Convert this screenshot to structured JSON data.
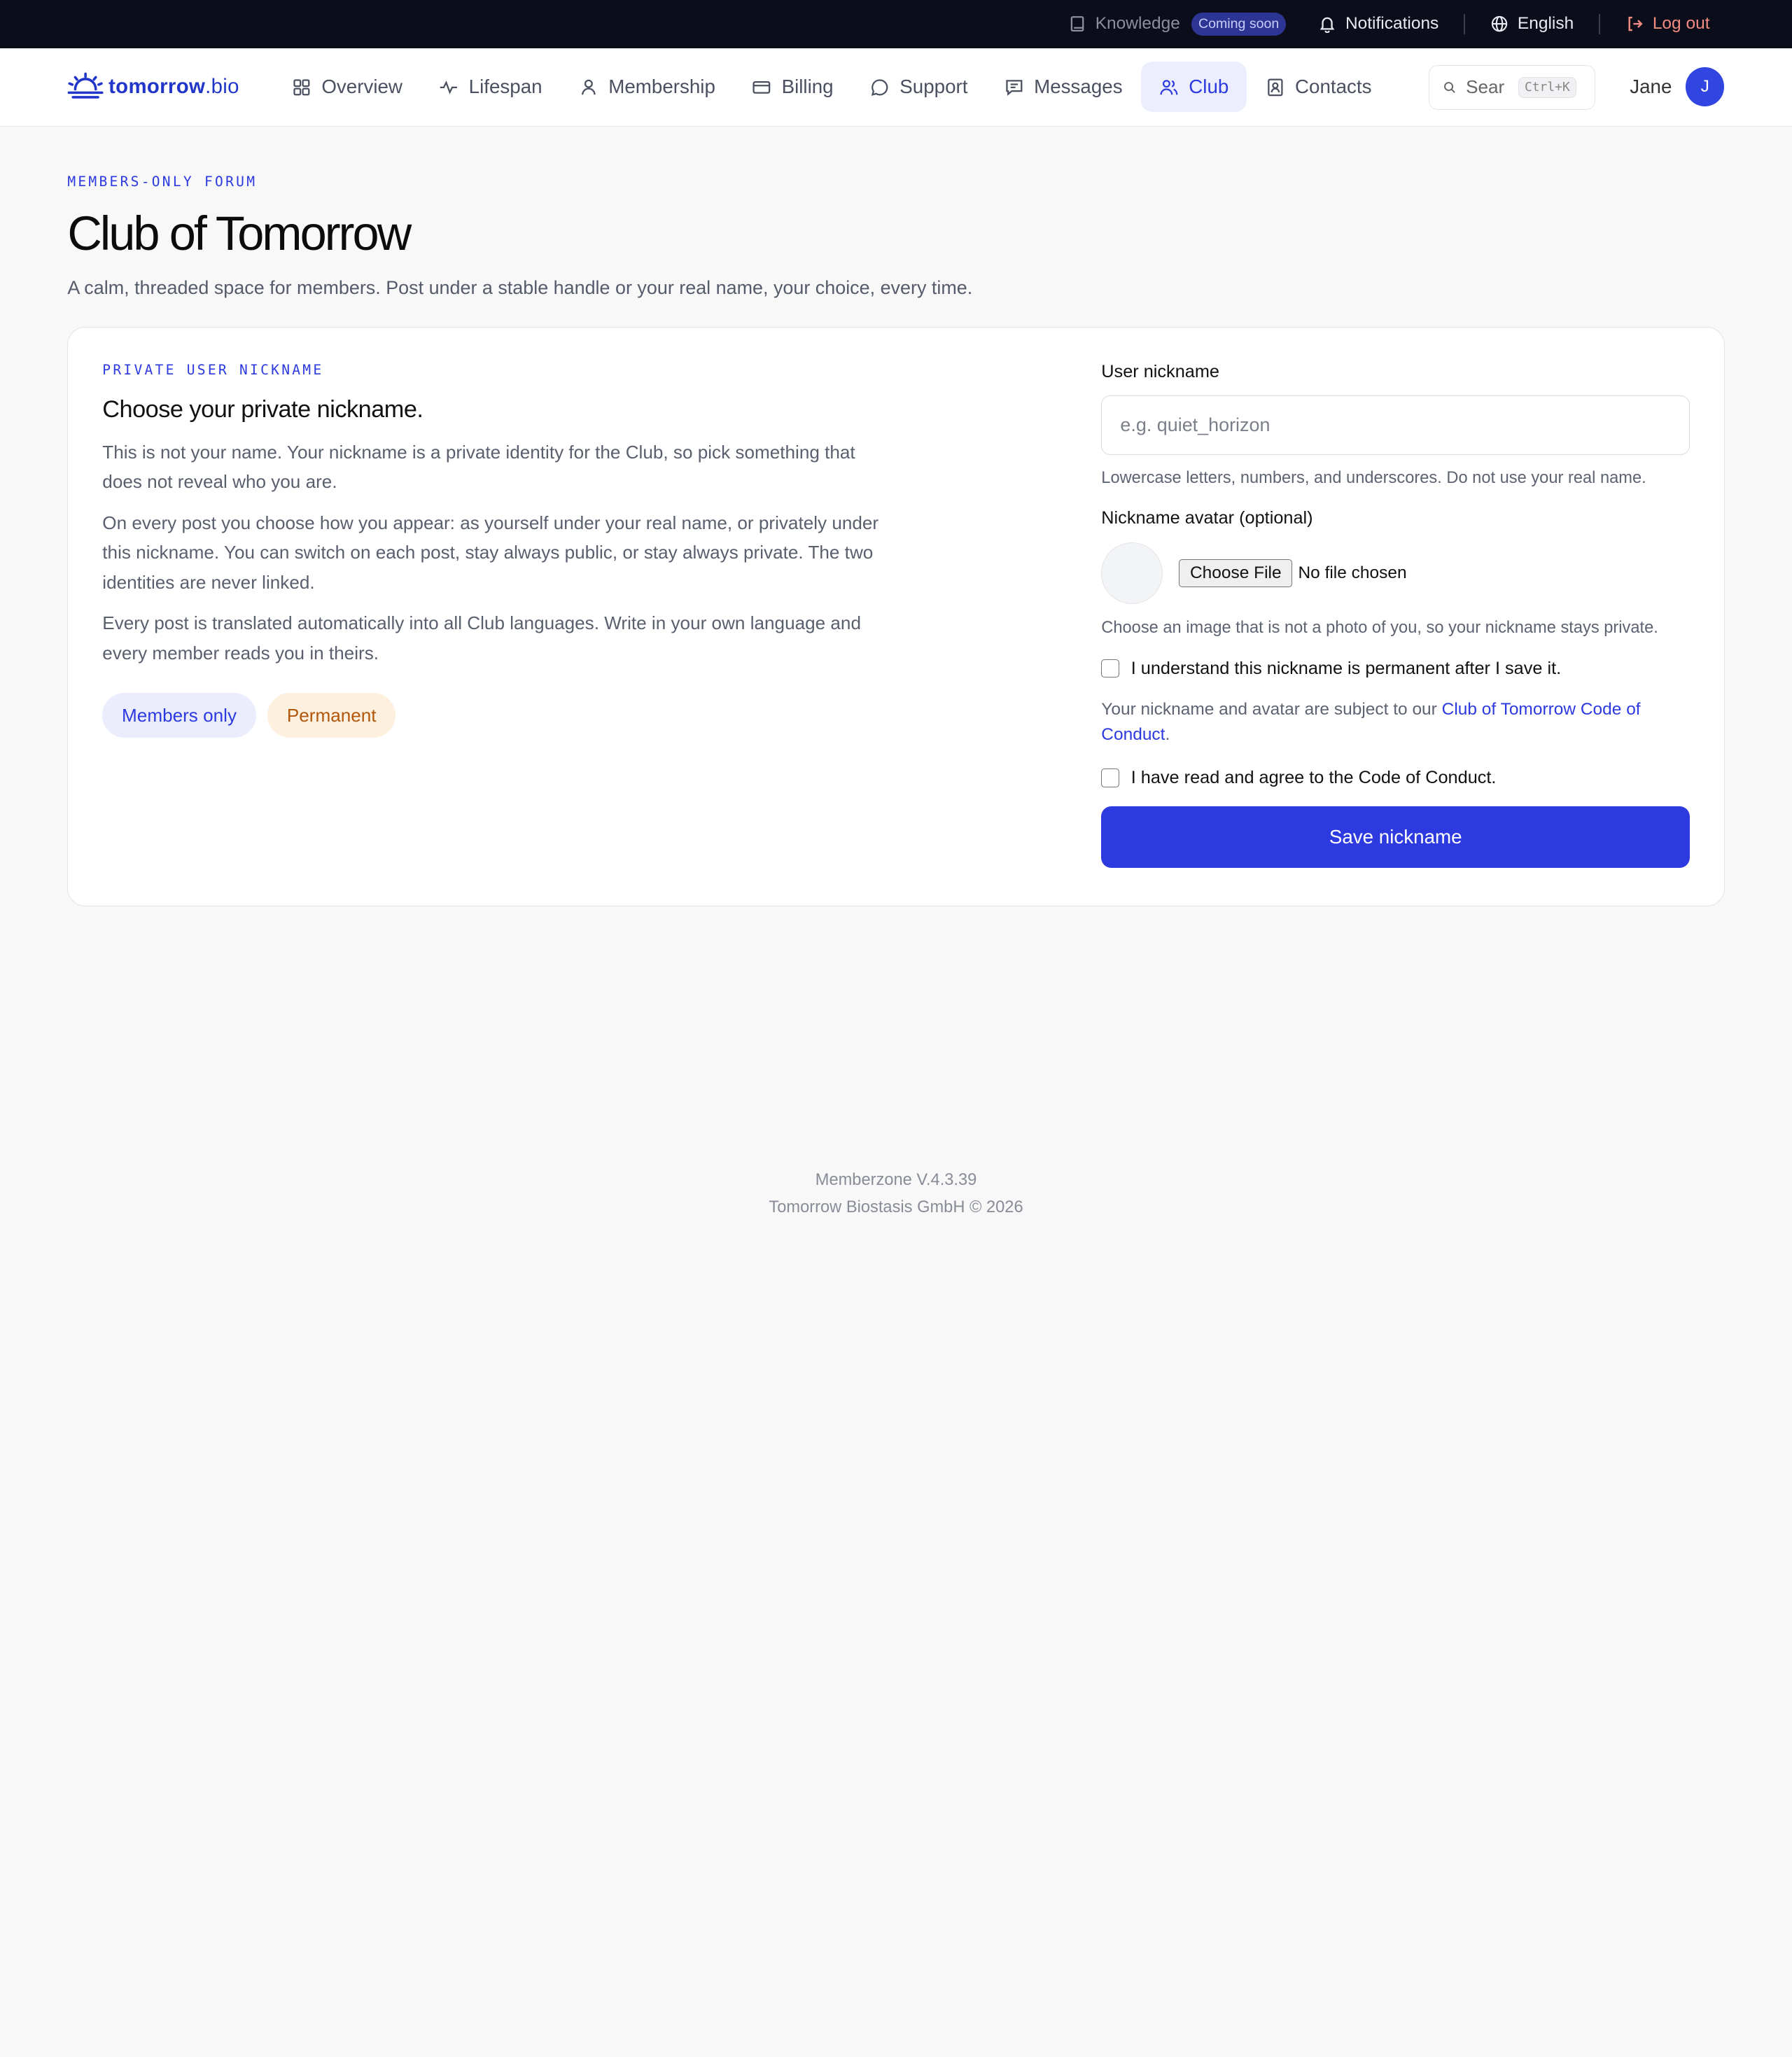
{
  "topbar": {
    "knowledge": "Knowledge",
    "coming_soon": "Coming soon",
    "notifications": "Notifications",
    "language": "English",
    "logout": "Log out"
  },
  "nav": {
    "logo_main": "tomorrow",
    "logo_suffix": ".bio",
    "items": [
      {
        "label": "Overview",
        "icon": "grid-icon"
      },
      {
        "label": "Lifespan",
        "icon": "pulse-icon"
      },
      {
        "label": "Membership",
        "icon": "person-icon"
      },
      {
        "label": "Billing",
        "icon": "card-icon"
      },
      {
        "label": "Support",
        "icon": "chat-bubble-icon"
      },
      {
        "label": "Messages",
        "icon": "message-icon"
      },
      {
        "label": "Club",
        "icon": "users-icon",
        "active": true
      },
      {
        "label": "Contacts",
        "icon": "contact-card-icon"
      }
    ],
    "search_placeholder": "Sear",
    "search_shortcut": "Ctrl+K",
    "user_name": "Jane",
    "user_initial": "J"
  },
  "hero": {
    "eyebrow": "MEMBERS-ONLY FORUM",
    "title": "Club of Tomorrow",
    "subtitle": "A calm, threaded space for members. Post under a stable handle or your real name, your choice, every time."
  },
  "card": {
    "eyebrow": "PRIVATE USER NICKNAME",
    "heading": "Choose your private nickname.",
    "paragraphs": [
      "This is not your name. Your nickname is a private identity for the Club, so pick something that does not reveal who you are.",
      "On every post you choose how you appear: as yourself under your real name, or privately under this nickname. You can switch on each post, stay always public, or stay always private. The two identities are never linked.",
      "Every post is translated automatically into all Club languages. Write in your own language and every member reads you in theirs."
    ],
    "pills": [
      "Members only",
      "Permanent"
    ],
    "form": {
      "nickname_label": "User nickname",
      "nickname_placeholder": "e.g. quiet_horizon",
      "nickname_help": "Lowercase letters, numbers, and underscores. Do not use your real name.",
      "avatar_label": "Nickname avatar (optional)",
      "choose_file": "Choose File",
      "no_file": "No file chosen",
      "avatar_help": "Choose an image that is not a photo of you, so your nickname stays private.",
      "permanent_check": "I understand this nickname is permanent after I save it.",
      "conduct_prefix": "Your nickname and avatar are subject to our ",
      "conduct_link": "Club of Tomorrow Code of Conduct",
      "conduct_suffix": ".",
      "agree_check": "I have read and agree to the Code of Conduct.",
      "save": "Save nickname"
    }
  },
  "footer": {
    "version": "Memberzone V.4.3.39",
    "copyright": "Tomorrow Biostasis GmbH © 2026"
  },
  "colors": {
    "accent": "#2c3adf",
    "topbar": "#0b0e1a",
    "logout": "#f28b82"
  }
}
